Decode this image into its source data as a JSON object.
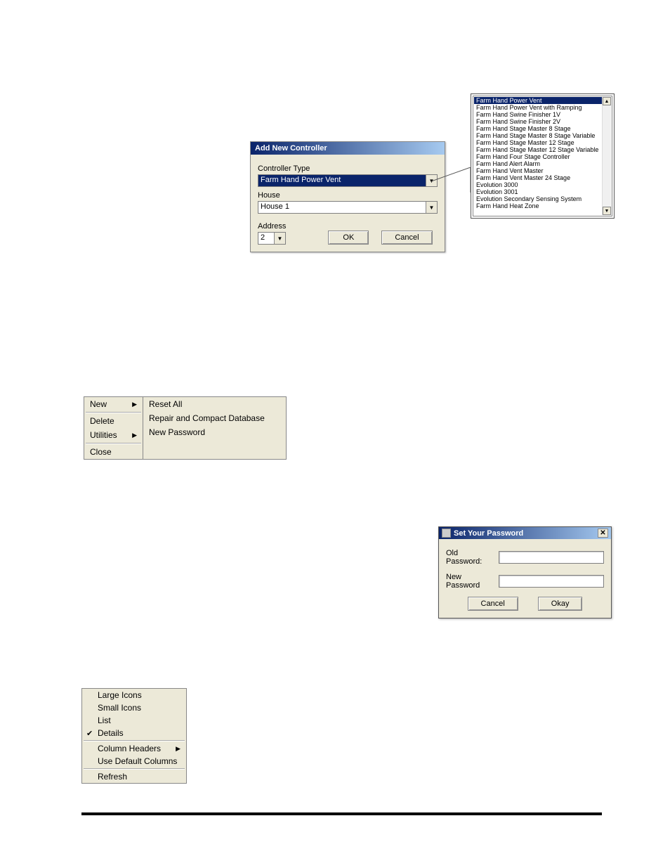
{
  "dialog_addnew": {
    "title": "Add New Controller",
    "controller_type_label": "Controller Type",
    "controller_type_value": "Farm Hand Power Vent",
    "house_label": "House",
    "house_value": "House 1",
    "address_label": "Address",
    "address_value": "2",
    "ok": "OK",
    "cancel": "Cancel"
  },
  "controller_types": [
    "Farm Hand Power Vent",
    "Farm Hand Power Vent with Ramping",
    "Farm Hand Swine Finisher 1V",
    "Farm Hand Swine Finisher 2V",
    "Farm Hand Stage Master 8 Stage",
    "Farm Hand Stage Master 8 Stage Variable",
    "Farm Hand Stage Master 12 Stage",
    "Farm Hand Stage Master 12 Stage Variable",
    "Farm Hand Four Stage Controller",
    "Farm Hand Alert Alarm",
    "Farm Hand Vent Master",
    "Farm Hand Vent Master 24 Stage",
    "Evolution 3000",
    "Evolution 3001",
    "Evolution Secondary Sensing System",
    "Farm Hand Heat Zone"
  ],
  "file_menu": {
    "new": "New",
    "delete": "Delete",
    "utilities": "Utilities",
    "close": "Close",
    "sub": {
      "reset_all": "Reset All",
      "repair": "Repair and Compact Database",
      "new_password": "New Password"
    }
  },
  "dialog_pwd": {
    "title": "Set Your Password",
    "old_label": "Old Password:",
    "new_label": "New Password",
    "cancel": "Cancel",
    "okay": "Okay"
  },
  "view_menu": {
    "large_icons": "Large Icons",
    "small_icons": "Small Icons",
    "list": "List",
    "details": "Details",
    "column_headers": "Column Headers",
    "use_default": "Use Default Columns",
    "refresh": "Refresh"
  }
}
